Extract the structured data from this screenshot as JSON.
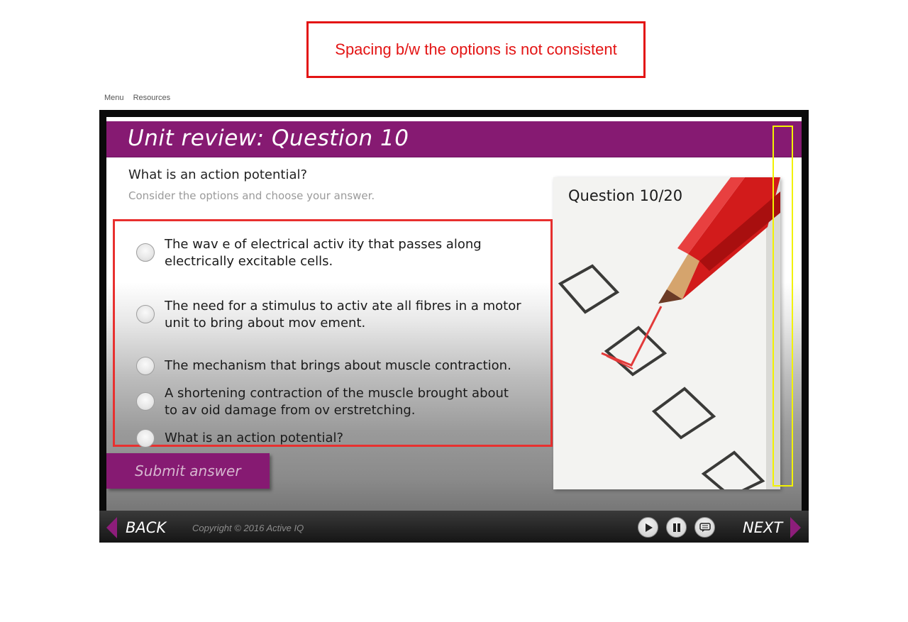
{
  "annotation": {
    "text": "Spacing b/w the options is not consistent"
  },
  "top_links": {
    "menu": "Menu",
    "resources": "Resources"
  },
  "slide": {
    "title": "Unit review: Question 10",
    "question": "What is an action potential?",
    "instruction": "Consider the options and choose your answer.",
    "options": [
      {
        "line1": "The wav e of electrical activ ity that passes along",
        "line2": "electrically excitable cells."
      },
      {
        "line1": "The need for a stimulus to activ ate all fibres in a motor",
        "line2": "unit to bring about mov ement."
      },
      {
        "line1": "The mechanism that brings about muscle contraction.",
        "line2": ""
      },
      {
        "line1": "A shortening contraction of the muscle brought about",
        "line2": "to av oid damage from ov erstretching."
      },
      {
        "line1": "What is an action potential?",
        "line2": ""
      }
    ],
    "submit_label": "Submit answer",
    "image_label": "Question 10/20"
  },
  "controls": {
    "back_label": "BACK",
    "next_label": "NEXT",
    "copyright": "Copyright © 2016 Active IQ"
  },
  "colors": {
    "brand_purple": "#861a72",
    "annotation_red": "#e31414",
    "highlight_yellow": "#f2f200"
  },
  "icons": [
    "arrow-left-icon",
    "arrow-right-icon",
    "play-icon",
    "pause-icon",
    "captions-icon",
    "radio-icon"
  ]
}
